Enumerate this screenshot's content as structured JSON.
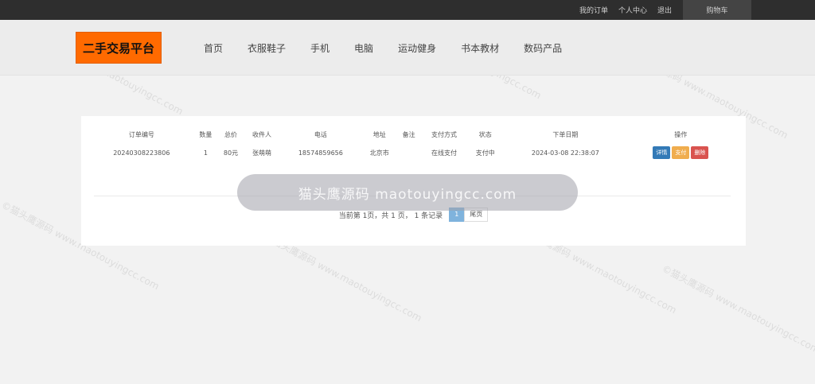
{
  "topbar": {
    "links": [
      "我的订单",
      "个人中心",
      "退出"
    ],
    "cart_label": "购物车"
  },
  "header": {
    "logo": "二手交易平台",
    "nav": [
      "首页",
      "衣服鞋子",
      "手机",
      "电脑",
      "运动健身",
      "书本教材",
      "数码产品"
    ]
  },
  "orders": {
    "columns": [
      "订单编号",
      "数量",
      "总价",
      "收件人",
      "电话",
      "地址",
      "备注",
      "支付方式",
      "状态",
      "下单日期",
      "操作"
    ],
    "rows": [
      {
        "order_no": "20240308223806",
        "qty": "1",
        "total": "80元",
        "receiver": "张萌萌",
        "phone": "18574859656",
        "address": "北京市",
        "note": "",
        "pay_method": "在线支付",
        "status": "支付中",
        "date": "2024-03-08 22:38:07",
        "actions": [
          "详情",
          "支付",
          "删除"
        ]
      }
    ]
  },
  "pagination": {
    "summary": "当前第 1页，共 1 页， 1 条记录",
    "current_page": "1",
    "last_label": "尾页"
  },
  "watermark": {
    "banner": "猫头鹰源码 maotouyingcc.com",
    "tile": "©猫头鹰源码 www.maotouyingcc.com"
  },
  "colors": {
    "topbar": "#2e2e2e",
    "logo_bg": "#ff6a00",
    "detail_btn": "#337ab7",
    "pay_btn": "#f0ad4e",
    "delete_btn": "#d9534f"
  }
}
